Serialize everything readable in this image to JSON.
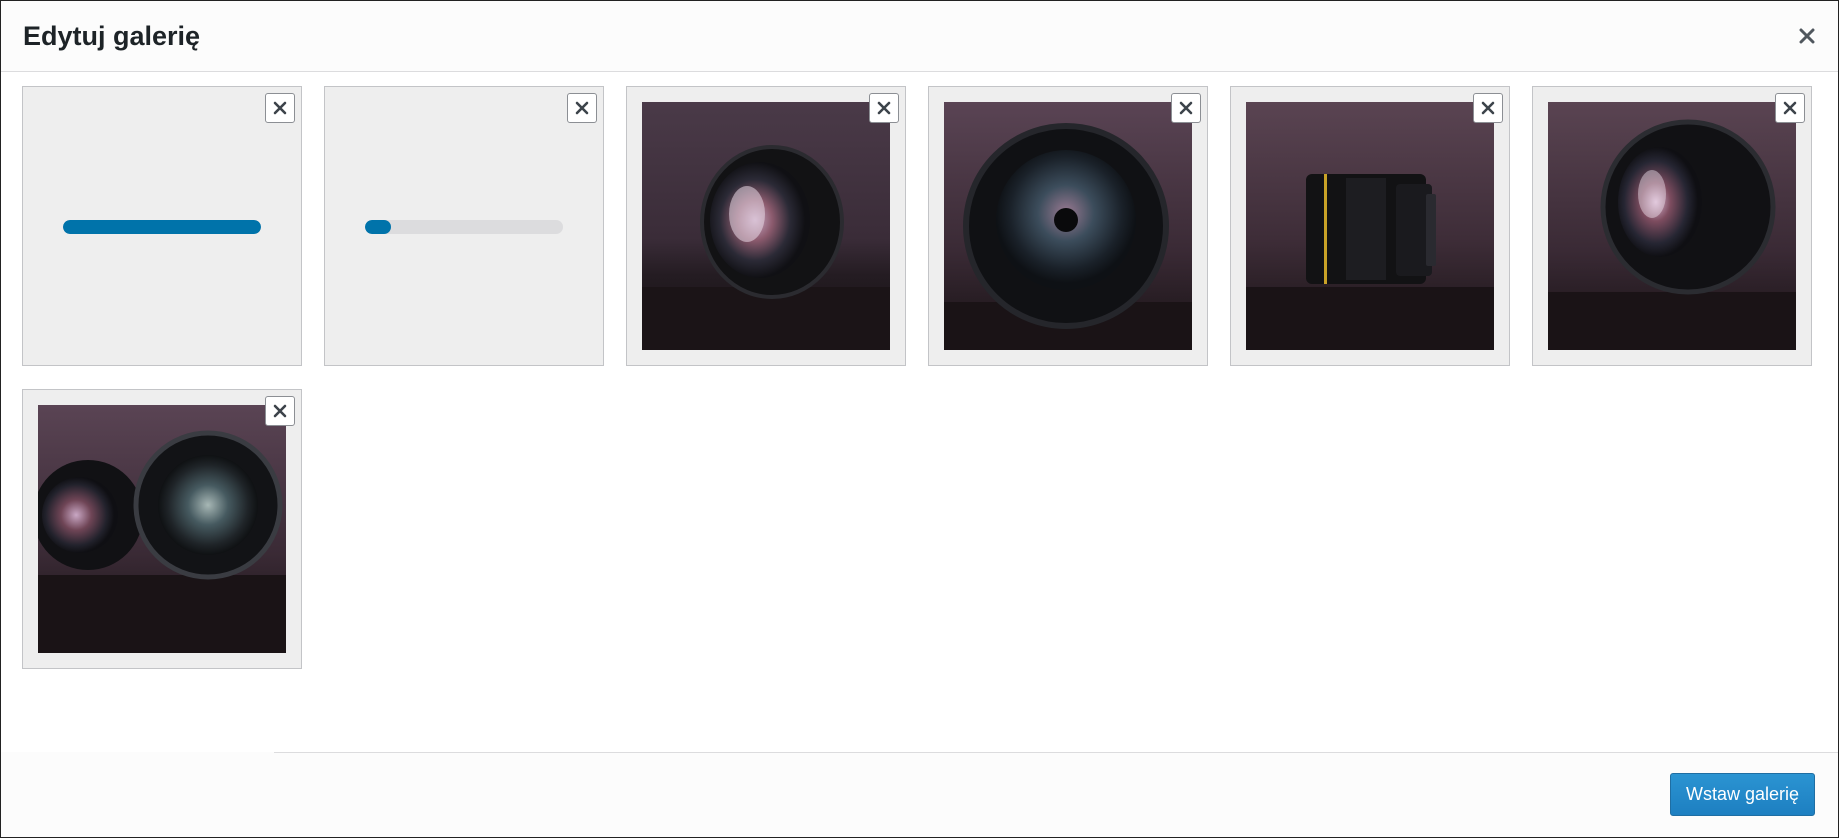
{
  "modal": {
    "title": "Edytuj galerię",
    "close_icon": "close-icon"
  },
  "gallery": {
    "items": [
      {
        "kind": "uploading",
        "progress": 1.0,
        "remove_icon": "close-icon"
      },
      {
        "kind": "uploading",
        "progress": 0.13,
        "remove_icon": "close-icon"
      },
      {
        "kind": "image",
        "subject": "camera lens, angled view",
        "remove_icon": "close-icon"
      },
      {
        "kind": "image",
        "subject": "camera lens, front view",
        "remove_icon": "close-icon"
      },
      {
        "kind": "image",
        "subject": "camera lens, side view",
        "remove_icon": "close-icon"
      },
      {
        "kind": "image",
        "subject": "camera lens, angled view",
        "remove_icon": "close-icon"
      },
      {
        "kind": "image",
        "subject": "two camera lenses",
        "remove_icon": "close-icon"
      }
    ]
  },
  "footer": {
    "insert_label": "Wstaw galerię"
  },
  "colors": {
    "accent": "#0073aa",
    "button": "#2a8bcb",
    "tile_bg": "#eeeeee",
    "track": "#dcdcde"
  }
}
